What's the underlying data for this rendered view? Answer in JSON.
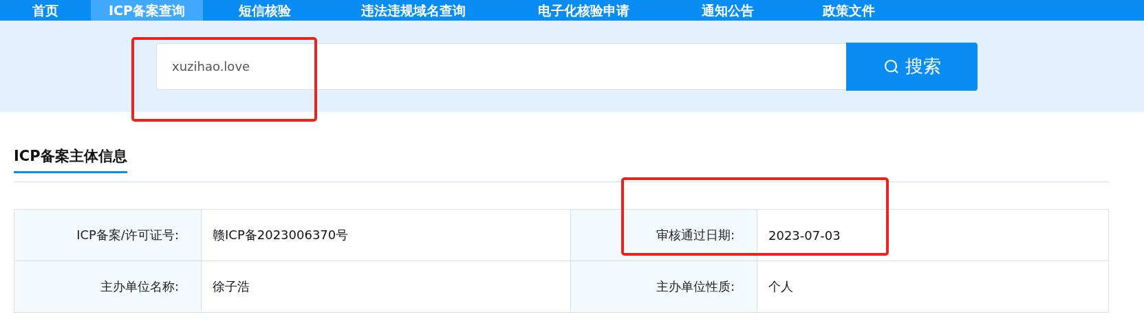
{
  "nav": [
    {
      "label": "首页",
      "selected": false
    },
    {
      "label": "ICP备案查询",
      "selected": true
    },
    {
      "label": "短信核验",
      "selected": false
    },
    {
      "label": "违法违规域名查询",
      "selected": false
    },
    {
      "label": "电子化核验申请",
      "selected": false
    },
    {
      "label": "通知公告",
      "selected": false
    },
    {
      "label": "政策文件",
      "selected": false
    }
  ],
  "search": {
    "value": "xuzihao.love",
    "button": "搜索",
    "highlighted": true
  },
  "section": {
    "title": "ICP备案主体信息"
  },
  "table": {
    "rows": [
      {
        "cells": [
          {
            "label": "ICP备案/许可证号:",
            "value": "赣ICP备2023006370号",
            "highlighted": false
          },
          {
            "label": "审核通过日期:",
            "value": "2023-07-03",
            "highlighted": true
          }
        ]
      },
      {
        "cells": [
          {
            "label": "主办单位名称:",
            "value": "徐子浩",
            "highlighted": false
          },
          {
            "label": "主办单位性质:",
            "value": "个人",
            "highlighted": false
          }
        ]
      }
    ]
  }
}
